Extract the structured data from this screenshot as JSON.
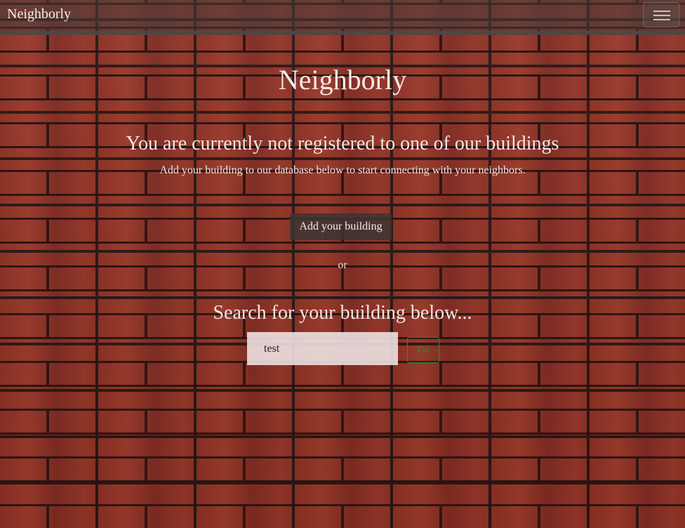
{
  "navbar": {
    "brand": "Neighborly",
    "menu_icon": "hamburger-menu-icon"
  },
  "main": {
    "title": "Neighborly",
    "notice": "You are currently not registered to one of our buildings",
    "subtext": "Add your building to our database below to start connecting with your neighbors.",
    "add_button_label": "Add your building",
    "or_text": "or",
    "search_heading": "Search for your building below...",
    "search_value": "test",
    "go_button_label": "Go"
  },
  "colors": {
    "brick": "#8a2f23",
    "mortar": "#2b1715",
    "navbar": "#463c3a",
    "go_button": "#2f8a3e"
  }
}
